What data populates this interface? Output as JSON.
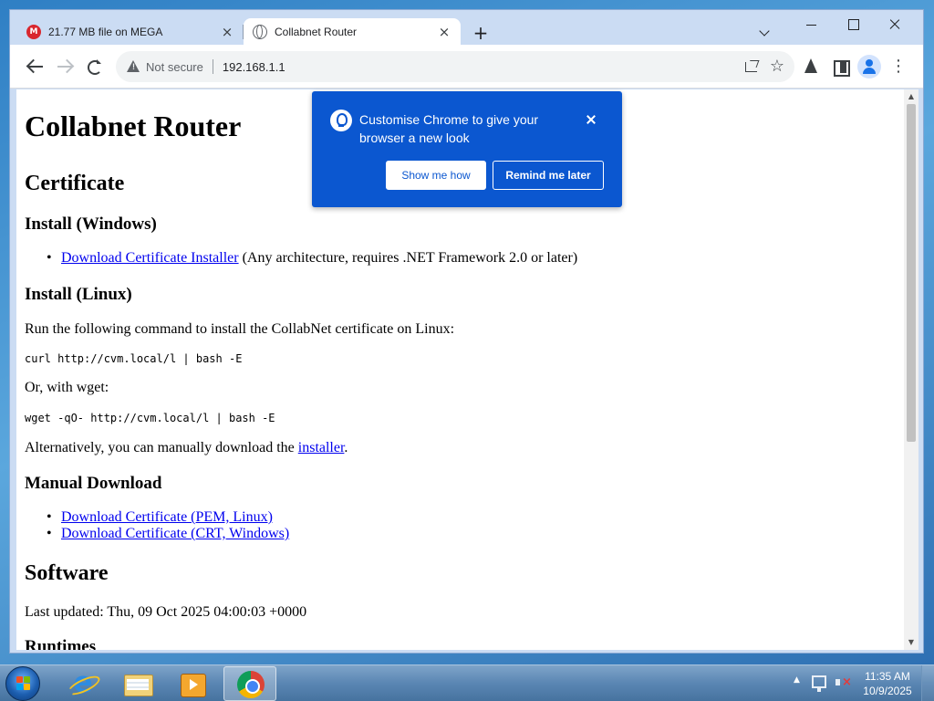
{
  "browser": {
    "tabs": [
      {
        "title": "21.77 MB file on MEGA",
        "icon": "mega-icon",
        "favicon_letter": "M",
        "active": false
      },
      {
        "title": "Collabnet Router",
        "icon": "globe-icon",
        "active": true
      }
    ],
    "new_tab_symbol": "+",
    "close_symbol": "×",
    "omnibox": {
      "security_label": "Not secure",
      "url": "192.168.1.1"
    },
    "star_symbol": "☆"
  },
  "page": {
    "title": "Collabnet Router",
    "certificate_heading": "Certificate",
    "install_windows_heading": "Install (Windows)",
    "windows_installer_link": "Download Certificate Installer",
    "windows_installer_note": " (Any architecture, requires .NET Framework 2.0 or later)",
    "install_linux_heading": "Install (Linux)",
    "linux_intro": "Run the following command to install the CollabNet certificate on Linux:",
    "curl_command": "curl http://cvm.local/l | bash -E",
    "wget_intro": "Or, with wget:",
    "wget_command": "wget -qO- http://cvm.local/l | bash -E",
    "manual_prefix": "Alternatively, you can manually download the ",
    "manual_link": "installer",
    "manual_suffix": ".",
    "manual_download_heading": "Manual Download",
    "pem_link": "Download Certificate (PEM, Linux)",
    "crt_link": "Download Certificate (CRT, Windows)",
    "software_heading": "Software",
    "last_updated": "Last updated: Thu, 09 Oct 2025 04:00:03 +0000",
    "runtimes_heading": "Runtimes"
  },
  "promo": {
    "message": "Customise Chrome to give your browser a new look",
    "show_button": "Show me how",
    "remind_button": "Remind me later"
  },
  "taskbar": {
    "apps": [
      "start-orb",
      "ie-icon",
      "folder-icon",
      "media-icon",
      "chrome-icon"
    ],
    "tray_up_symbol": "▲",
    "time": "11:35 AM",
    "date": "10/9/2025"
  },
  "colors": {
    "promo_bg": "#0b57d0",
    "link": "#0000ee",
    "taskbar": "#5a86b3"
  }
}
